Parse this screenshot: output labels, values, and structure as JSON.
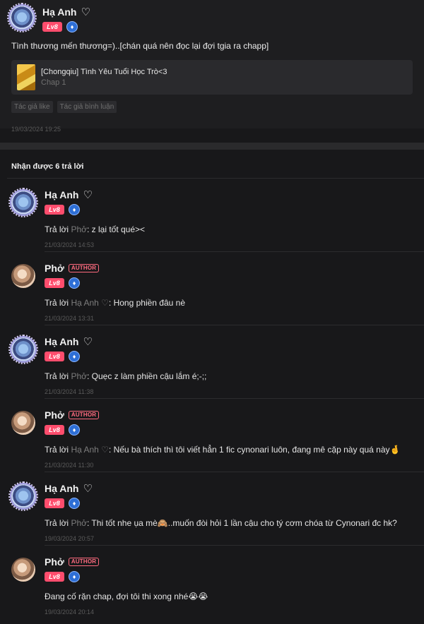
{
  "main_comment": {
    "author": "Hạ Anh",
    "heart": "♡",
    "level": "Lv8",
    "text": "Tình thương mến thương=)..[chán quá nên đọc lại đợi tgia ra chapp]",
    "chapter_card": {
      "title": "[Chongqiu] Tình Yêu Tuổi Học Trò<3",
      "subtitle": "Chap 1"
    },
    "tags": [
      "Tác giả like",
      "Tác giả bình luận"
    ],
    "date": "19/03/2024 19:25"
  },
  "replies_header": "Nhận được 6 trả lời",
  "reply_prefix": "Trả lời ",
  "author_tag": "AUTHOR",
  "replies": [
    {
      "author": "Hạ Anh",
      "heart": "♡",
      "level": "Lv8",
      "reply_to": "Phở",
      "text": ": z lại tốt qué><",
      "date": "21/03/2024 14:53"
    },
    {
      "author": "Phở",
      "is_author": true,
      "level": "Lv8",
      "reply_to": "Hạ Anh ♡",
      "text": ": Hong phiền đâu nè",
      "date": "21/03/2024 13:31"
    },
    {
      "author": "Hạ Anh",
      "heart": "♡",
      "level": "Lv8",
      "reply_to": "Phở",
      "text": ": Quẹc z làm phiền cậu lắm é;-;;",
      "date": "21/03/2024 11:38"
    },
    {
      "author": "Phở",
      "is_author": true,
      "level": "Lv8",
      "reply_to": "Hạ Anh ♡",
      "text": ": Nếu bà thích thì tôi viết hẳn 1 fic cynonari luôn, đang mê cặp này quá này🤞",
      "date": "21/03/2024 11:30"
    },
    {
      "author": "Hạ Anh",
      "heart": "♡",
      "level": "Lv8",
      "reply_to": "Phở",
      "text": ": Thi tốt nhe ụa mè🙈..muốn đòi hỏi 1 lần cậu cho tý cơm chóa từ Cynonari đc hk?",
      "date": "19/03/2024 20:57"
    },
    {
      "author": "Phở",
      "is_author": true,
      "level": "Lv8",
      "reply_to": "",
      "text": "Đang cố rặn chap, đợi tôi thi xong nhé😭😭",
      "date": "19/03/2024 20:14"
    }
  ]
}
